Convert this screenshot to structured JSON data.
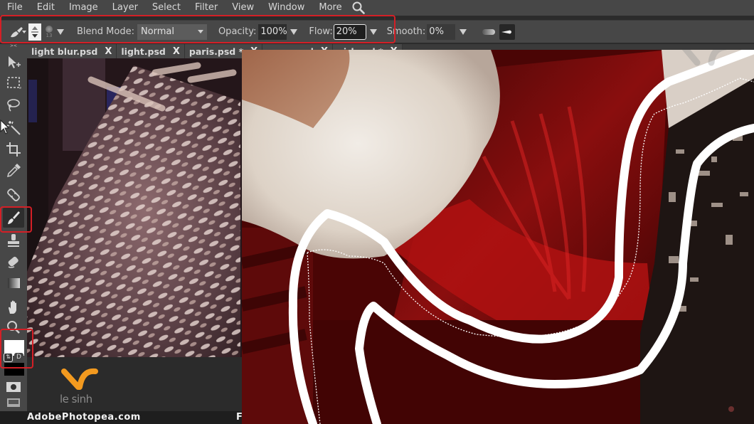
{
  "menubar": {
    "items": [
      "File",
      "Edit",
      "Image",
      "Layer",
      "Select",
      "Filter",
      "View",
      "Window",
      "More"
    ],
    "search_icon": "search-icon"
  },
  "options": {
    "tool_icon": "brush-icon",
    "brush_size": "13",
    "blend_mode_label": "Blend Mode:",
    "blend_mode_value": "Normal",
    "opacity_label": "Opacity:",
    "opacity_value": "100%",
    "flow_label": "Flow:",
    "flow_value": "20%",
    "smooth_label": "Smooth:",
    "smooth_value": "0%"
  },
  "tabs": [
    {
      "label": "light blur.psd",
      "close": "X"
    },
    {
      "label": "light.psd",
      "close": "X"
    },
    {
      "label": "paris.psd *",
      "close": "X"
    },
    {
      "label": "snow.psd",
      "close": "X"
    },
    {
      "label": "girl.psd *",
      "close": "X"
    }
  ],
  "tools": [
    {
      "name": "move-tool",
      "icon": "move-icon"
    },
    {
      "name": "marquee-tool",
      "icon": "marquee-icon"
    },
    {
      "name": "lasso-tool",
      "icon": "lasso-icon"
    },
    {
      "name": "magic-wand-tool",
      "icon": "magic-wand-icon"
    },
    {
      "name": "crop-tool",
      "icon": "crop-icon"
    },
    {
      "name": "eyedropper-tool",
      "icon": "eyedropper-icon"
    },
    {
      "name": "healing-tool",
      "icon": "bandage-icon"
    },
    {
      "name": "brush-tool",
      "icon": "brush-icon",
      "active": true
    },
    {
      "name": "clone-stamp-tool",
      "icon": "stamp-icon"
    },
    {
      "name": "eraser-tool",
      "icon": "eraser-icon"
    },
    {
      "name": "gradient-tool",
      "icon": "gradient-icon"
    },
    {
      "name": "hand-tool",
      "icon": "hand-icon"
    },
    {
      "name": "zoom-tool",
      "icon": "zoom-icon"
    }
  ],
  "colors": {
    "foreground": "#ffffff",
    "background": "#000000",
    "swap_label": "⇅",
    "default_label": "D",
    "highlight": "#d41f26"
  },
  "watermark": {
    "logo_text": "le sinh",
    "site": "AdobePhotopea.com",
    "site_trailing": "F",
    "logo_color": "#f39a1f"
  }
}
